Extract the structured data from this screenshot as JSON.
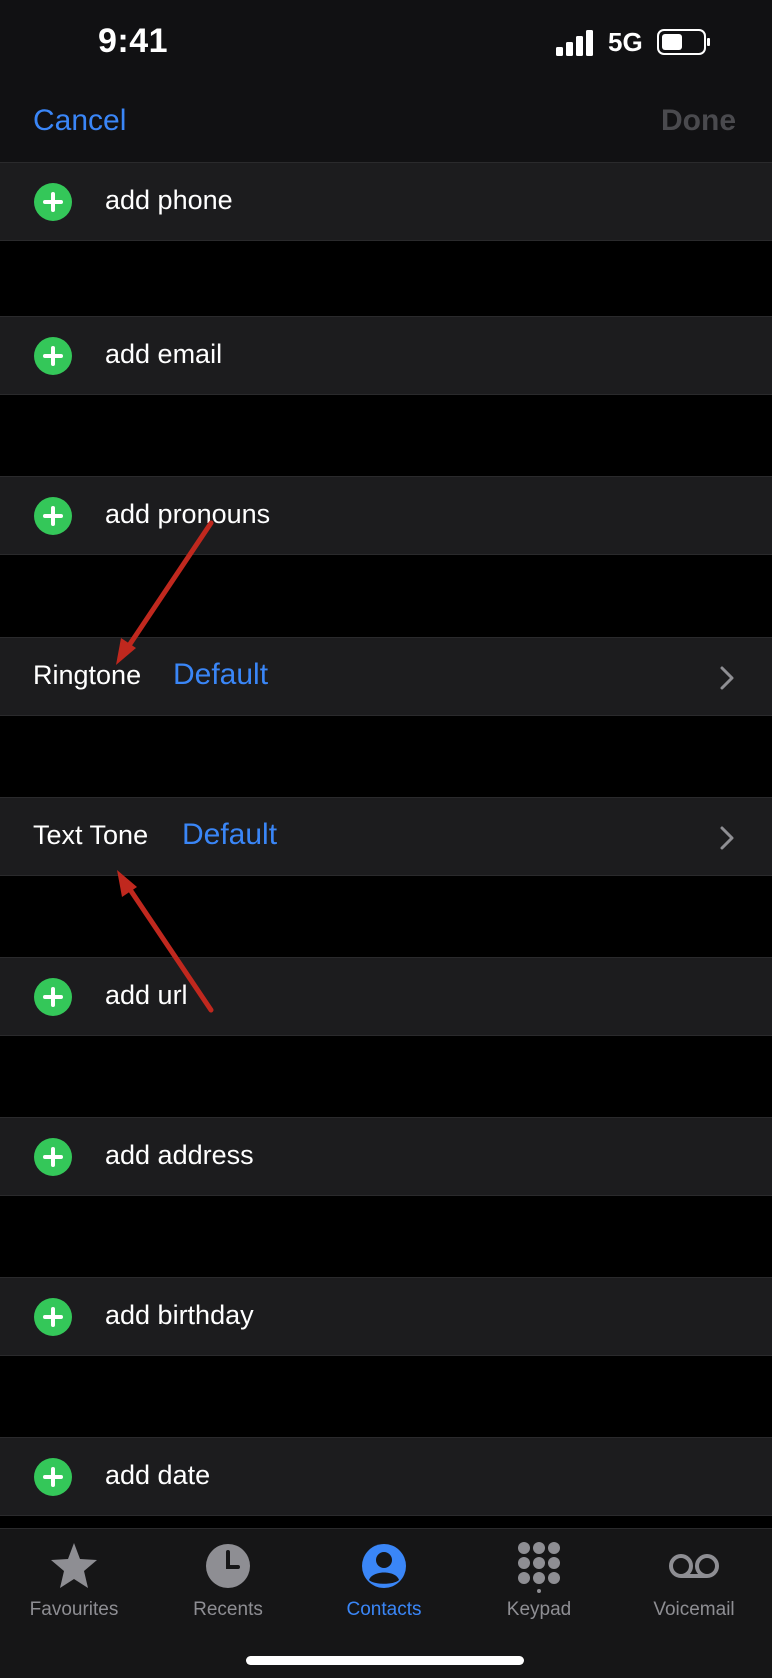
{
  "status_bar": {
    "time": "9:41",
    "network": "5G"
  },
  "nav": {
    "cancel_label": "Cancel",
    "done_label": "Done"
  },
  "rows": {
    "add_phone": "add phone",
    "add_email": "add email",
    "add_pronouns": "add pronouns",
    "ringtone_label": "Ringtone",
    "ringtone_value": "Default",
    "text_tone_label": "Text Tone",
    "text_tone_value": "Default",
    "add_url": "add url",
    "add_address": "add address",
    "add_birthday": "add birthday",
    "add_date": "add date"
  },
  "tabs": [
    {
      "label": "Favourites",
      "icon": "star-icon"
    },
    {
      "label": "Recents",
      "icon": "clock-icon"
    },
    {
      "label": "Contacts",
      "icon": "person-icon",
      "active": true
    },
    {
      "label": "Keypad",
      "icon": "keypad-icon"
    },
    {
      "label": "Voicemail",
      "icon": "voicemail-icon"
    }
  ],
  "colors": {
    "accent": "#3a86f7",
    "add_green": "#34c759",
    "annotation_red": "#c0281e"
  }
}
